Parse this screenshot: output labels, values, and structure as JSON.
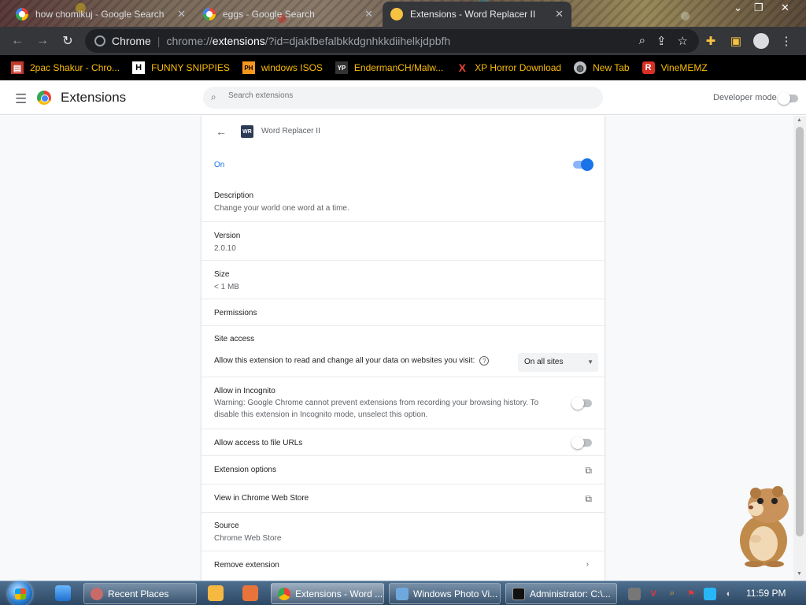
{
  "tabs": [
    {
      "title": "how chomikuj - Google Search",
      "active": false
    },
    {
      "title": "eggs - Google Search",
      "active": false
    },
    {
      "title": "Extensions - Word Replacer II",
      "active": true
    }
  ],
  "omnibox": {
    "site_name": "Chrome",
    "url_scheme": "chrome://",
    "url_host": "extensions",
    "url_path": "/?id=djakfbefalbkkdgnhkkdiihelkjdpbfh"
  },
  "bookmarks": [
    {
      "label": "2pac Shakur - Chro...",
      "icon": "image-icon",
      "color": "#e8eaed"
    },
    {
      "label": "FUNNY SNIPPIES",
      "icon": "H",
      "color": "#ffffff"
    },
    {
      "label": "windows ISOS",
      "icon": "PH",
      "color": "#f7971d"
    },
    {
      "label": "EndermanCH/Malw...",
      "icon": "YP",
      "color": "#ffffff"
    },
    {
      "label": "XP Horror Download",
      "icon": "X",
      "color": "#ea4335"
    },
    {
      "label": "New Tab",
      "icon": "globe-icon",
      "color": "#bdc1c6"
    },
    {
      "label": "VineMEMZ",
      "icon": "R",
      "color": "#d93025"
    }
  ],
  "header": {
    "title": "Extensions",
    "search_placeholder": "Search extensions",
    "developer_mode_label": "Developer mode",
    "developer_mode_on": false
  },
  "extension": {
    "name": "Word Replacer II",
    "logo_text": "WR",
    "state_label": "On",
    "enabled": true,
    "description_label": "Description",
    "description": "Change your world one word at a time.",
    "version_label": "Version",
    "version": "2.0.10",
    "size_label": "Size",
    "size": "< 1 MB",
    "permissions_label": "Permissions",
    "site_access_label": "Site access",
    "site_access_text": "Allow this extension to read and change all your data on websites you visit:",
    "site_access_value": "On all sites",
    "incognito_label": "Allow in Incognito",
    "incognito_warning": "Warning: Google Chrome cannot prevent extensions from recording your browsing history. To disable this extension in Incognito mode, unselect this option.",
    "incognito_on": false,
    "file_urls_label": "Allow access to file URLs",
    "file_urls_on": false,
    "options_label": "Extension options",
    "webstore_label": "View in Chrome Web Store",
    "source_label": "Source",
    "source": "Chrome Web Store",
    "remove_label": "Remove extension"
  },
  "taskbar": {
    "items": [
      {
        "label": "Recent Places"
      },
      {
        "label": "Extensions - Word ..."
      },
      {
        "label": "Windows Photo Vi..."
      },
      {
        "label": "Administrator: C:\\..."
      }
    ],
    "clock": "11:59 PM"
  },
  "colors": {
    "accent": "#1a73e8",
    "bookmark_text": "#fbbc05"
  }
}
